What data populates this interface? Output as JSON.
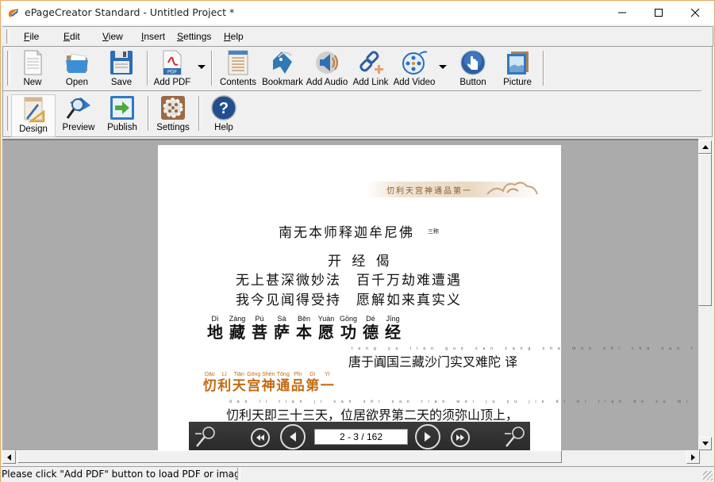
{
  "window": {
    "title": "ePageCreator Standard - Untitled Project *",
    "controls": {
      "minimize": "minimize",
      "maximize": "maximize",
      "close": "close"
    },
    "accent": "#e3a866"
  },
  "menubar": {
    "items": [
      {
        "label": "File",
        "accel": "F"
      },
      {
        "label": "Edit",
        "accel": "E"
      },
      {
        "label": "View",
        "accel": "V"
      },
      {
        "label": "Insert",
        "accel": "I"
      },
      {
        "label": "Settings",
        "accel": "S"
      },
      {
        "label": "Help",
        "accel": "H"
      }
    ]
  },
  "toolbar1": {
    "buttons": [
      {
        "label": "New",
        "icon": "new-document-icon"
      },
      {
        "label": "Open",
        "icon": "open-folder-icon"
      },
      {
        "label": "Save",
        "icon": "floppy-disk-icon"
      },
      {
        "label": "Add PDF",
        "icon": "pdf-icon",
        "dropdown": true
      },
      {
        "label": "Contents",
        "icon": "contents-icon"
      },
      {
        "label": "Bookmark",
        "icon": "bookmark-icon"
      },
      {
        "label": "Add Audio",
        "icon": "speaker-icon"
      },
      {
        "label": "Add Link",
        "icon": "link-icon"
      },
      {
        "label": "Add Video",
        "icon": "film-reel-icon",
        "dropdown": true
      },
      {
        "label": "Button",
        "icon": "hand-button-icon"
      },
      {
        "label": "Picture",
        "icon": "picture-icon"
      }
    ]
  },
  "toolbar2": {
    "buttons": [
      {
        "label": "Design",
        "icon": "design-icon",
        "active": true
      },
      {
        "label": "Preview",
        "icon": "preview-icon"
      },
      {
        "label": "Publish",
        "icon": "publish-arrow-icon"
      },
      {
        "label": "Settings",
        "icon": "gear-icon"
      },
      {
        "label": "Help",
        "icon": "help-icon"
      }
    ]
  },
  "document": {
    "banner": "忉利天宫神通品第一",
    "invocation": "南无本师释迦牟尼佛",
    "invocation_note": "三称",
    "gatha_title": "开 经 偈",
    "gatha_lines": [
      "无上甚深微妙法　百千万劫难遭遇",
      "我今见闻得受持　愿解如来真实义"
    ],
    "sutra_title_pinyin": [
      "Dì",
      "Zàng",
      "Pú",
      "Sà",
      "Běn",
      "Yuàn",
      "Gōng",
      "Dé",
      "Jīng"
    ],
    "sutra_title": [
      "地",
      "藏",
      "菩",
      "萨",
      "本",
      "愿",
      "功",
      "德",
      "经"
    ],
    "translator": "唐于阗国三藏沙门实叉难陀 译",
    "chapter_pinyin": [
      "Dāo",
      "Lì",
      "Tiān",
      "Gōng",
      "Shén",
      "Tōng",
      "Pǐn",
      "Dì",
      "Yī"
    ],
    "chapter_title": "忉利天宫神通品第一",
    "body_line": "忉利天即三十三天，位居欲界第二天的须弥山顶上，",
    "chapter_color": "#c46a10"
  },
  "viewer": {
    "page_indicator": "2 - 3 / 162"
  },
  "status": {
    "message": "Please click \"Add PDF\" button to load PDF or image"
  }
}
